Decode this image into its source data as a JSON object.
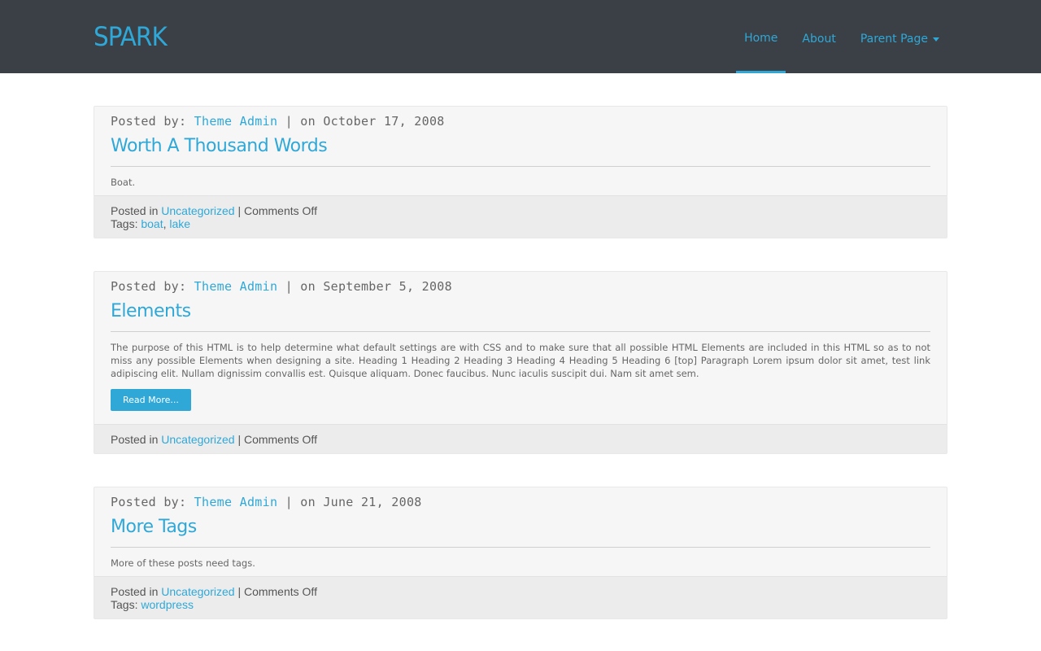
{
  "site": {
    "logo": "SPARK"
  },
  "nav": {
    "items": [
      {
        "label": "Home"
      },
      {
        "label": "About"
      },
      {
        "label": "Parent Page"
      }
    ]
  },
  "colors": {
    "accent": "#2fa8d8",
    "header_bg": "#3a4046"
  },
  "posts": [
    {
      "posted_by_label": "Posted by:",
      "author": "Theme Admin",
      "date_sep": "| on",
      "date": "October 17, 2008",
      "title": "Worth A Thousand Words",
      "excerpt": "Boat.",
      "posted_in_label": "Posted in",
      "category": "Uncategorized",
      "comments": "| Comments Off",
      "tags_label": "Tags:",
      "tags": [
        "boat",
        "lake"
      ]
    },
    {
      "posted_by_label": "Posted by:",
      "author": "Theme Admin",
      "date_sep": "| on",
      "date": "September 5, 2008",
      "title": "Elements",
      "excerpt": "The purpose of this HTML is to help determine what default settings are with CSS and to make sure that all possible HTML Elements are included in this HTML so as to not miss any possible Elements when designing a site. Heading 1 Heading 2 Heading 3 Heading 4 Heading 5 Heading 6 [top] Paragraph Lorem ipsum dolor sit amet, test link adipiscing elit. Nullam dignissim convallis est. Quisque aliquam. Donec faucibus. Nunc iaculis suscipit dui. Nam sit amet sem.",
      "read_more": "Read More...",
      "posted_in_label": "Posted in",
      "category": "Uncategorized",
      "comments": "| Comments Off"
    },
    {
      "posted_by_label": "Posted by:",
      "author": "Theme Admin",
      "date_sep": "| on",
      "date": "June 21, 2008",
      "title": "More Tags",
      "excerpt": "More of these posts need tags.",
      "posted_in_label": "Posted in",
      "category": "Uncategorized",
      "comments": "| Comments Off",
      "tags_label": "Tags:",
      "tags": [
        "wordpress"
      ]
    }
  ]
}
